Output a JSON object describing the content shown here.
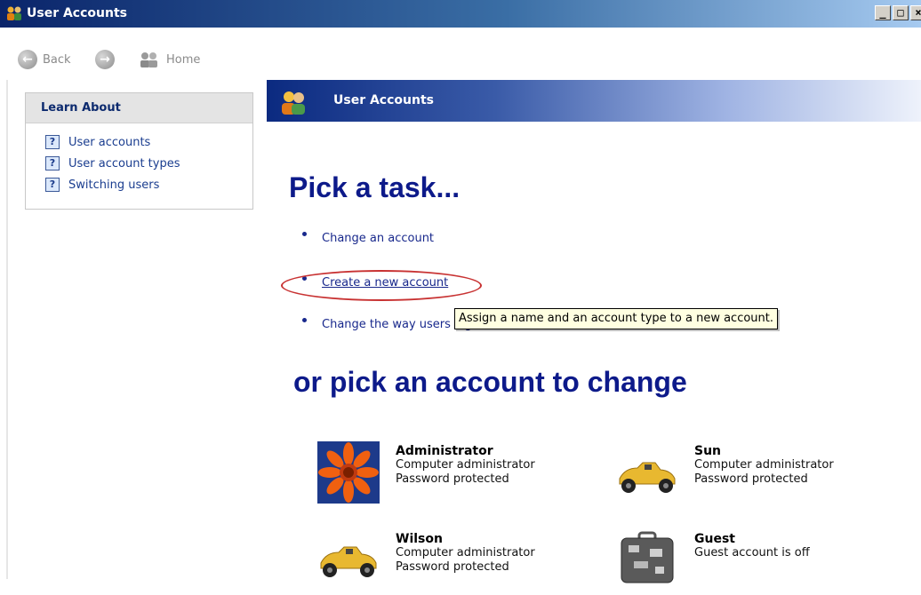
{
  "window": {
    "title": "User Accounts",
    "controls": [
      "_",
      "□",
      "×"
    ]
  },
  "toolbar": {
    "back_label": "Back",
    "home_label": "Home"
  },
  "learn_about": {
    "heading": "Learn About",
    "items": [
      {
        "label": "User accounts",
        "icon": "help-icon"
      },
      {
        "label": "User account types",
        "icon": "help-icon"
      },
      {
        "label": "Switching users",
        "icon": "help-icon"
      }
    ]
  },
  "banner": {
    "title": "User Accounts"
  },
  "main": {
    "pick_task_heading": "Pick a task...",
    "tasks": [
      {
        "label": "Change an account"
      },
      {
        "label": "Create a new account"
      },
      {
        "label": "Change the way users log on or off"
      }
    ],
    "tooltip": "Assign a name and an account type to a new account.",
    "pick_account_heading": "or pick an account to change",
    "accounts": [
      {
        "name": "Administrator",
        "line1": "Computer administrator",
        "line2": "Password protected",
        "picture": "flower-icon"
      },
      {
        "name": "Sun",
        "line1": "Computer administrator",
        "line2": "Password protected",
        "picture": "race-car-icon"
      },
      {
        "name": "Wilson",
        "line1": "Computer administrator",
        "line2": "Password protected",
        "picture": "race-car-icon"
      },
      {
        "name": "Guest",
        "line1": "Guest account is off",
        "line2": "",
        "picture": "suitcase-icon"
      }
    ]
  },
  "colors": {
    "heading": "#0d1a8a",
    "link": "#18288c",
    "titlebar": "#0a246a",
    "highlight": "#c83232"
  }
}
